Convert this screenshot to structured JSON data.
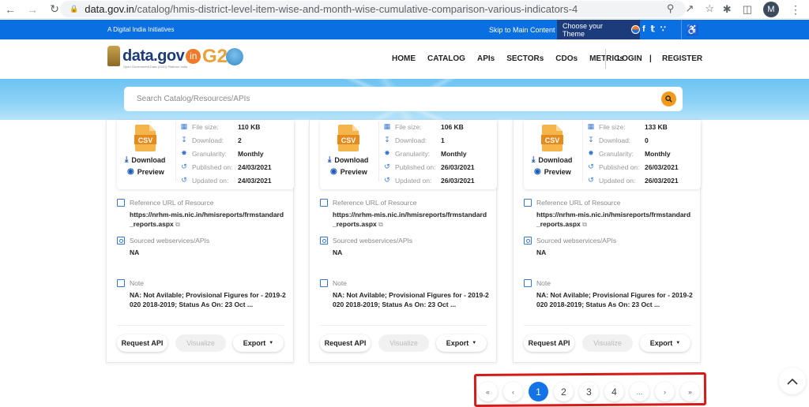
{
  "browser": {
    "url_host": "data.gov.in",
    "url_path": "/catalog/hmis-district-level-item-wise-and-month-wise-cumulative-comparison-various-indicators-4",
    "profile_initial": "M"
  },
  "topbar": {
    "tagline": "A Digital India Initiatives",
    "skip_link": "Skip to Main Content",
    "theme_label": "Choose your Theme"
  },
  "header": {
    "logo_text": "data.gov",
    "logo_in": "in",
    "logo_sub": "Open Government Data (OGD) Platform India",
    "g20_text": "G2",
    "nav": [
      "HOME",
      "CATALOG",
      "APIs",
      "SECTORs",
      "CDOs",
      "METRICs"
    ],
    "login": "LOGIN",
    "separator": "|",
    "register": "REGISTER"
  },
  "search": {
    "placeholder": "Search Catalog/Resources/APIs"
  },
  "labels": {
    "download": "Download",
    "preview": "Preview",
    "file_size": "File size:",
    "downloads": "Download:",
    "granularity": "Granularity:",
    "published": "Published on:",
    "updated": "Updated on:",
    "ref_url": "Reference URL of Resource",
    "sourced": "Sourced webservices/APIs",
    "note": "Note",
    "request_api": "Request API",
    "visualize": "Visualize",
    "export": "Export",
    "csv": "CSV"
  },
  "cards": [
    {
      "file_size": "110 KB",
      "downloads": "2",
      "granularity": "Monthly",
      "published": "24/03/2021",
      "updated": "24/03/2021",
      "ref_url": "https://nrhm-mis.nic.in/hmisreports/frmstandard_reports.aspx",
      "sourced": "NA",
      "note": "NA: Not Avilable; Provisional Figures for - 2019-2020 2018-2019; Status As On: 23 Oct ..."
    },
    {
      "file_size": "106 KB",
      "downloads": "1",
      "granularity": "Monthly",
      "published": "26/03/2021",
      "updated": "26/03/2021",
      "ref_url": "https://nrhm-mis.nic.in/hmisreports/frmstandard_reports.aspx",
      "sourced": "NA",
      "note": "NA: Not Avilable; Provisional Figures for - 2019-2020 2018-2019; Status As On: 23 Oct ..."
    },
    {
      "file_size": "133 KB",
      "downloads": "0",
      "granularity": "Monthly",
      "published": "26/03/2021",
      "updated": "26/03/2021",
      "ref_url": "https://nrhm-mis.nic.in/hmisreports/frmstandard_reports.aspx",
      "sourced": "NA",
      "note": "NA: Not Avilable; Provisional Figures for - 2019-2020 2018-2019; Status As On: 23 Oct ..."
    }
  ],
  "pagination": {
    "first": "«",
    "prev": "‹",
    "pages": [
      "1",
      "2",
      "3",
      "4"
    ],
    "ellipsis": "...",
    "next": "›",
    "last": "»",
    "current": "1"
  },
  "colors": {
    "topbar_blue": "#0a6fe0",
    "theme_navy": "#1c3b7a",
    "accent_orange": "#f39a1a",
    "active_page": "#1473e6",
    "annotation_red": "#d61a1a"
  }
}
